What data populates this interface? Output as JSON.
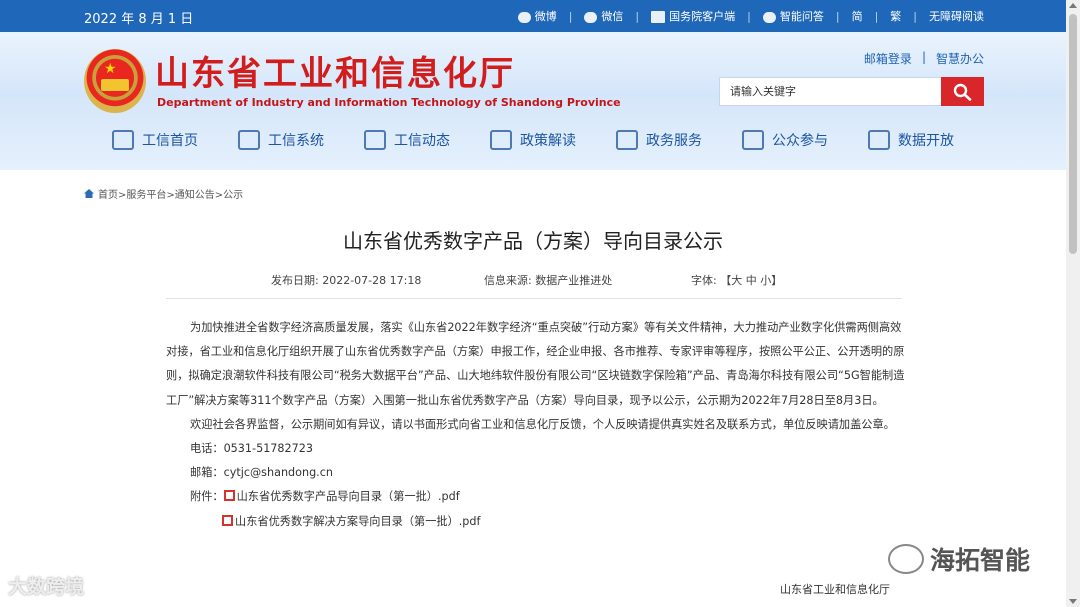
{
  "topbar": {
    "date": "2022 年 8 月 1 日",
    "links": [
      "微博",
      "微信",
      "国务院客户端",
      "智能问答",
      "简",
      "繁",
      "无障碍阅读"
    ]
  },
  "header": {
    "site_name": "山东省工业和信息化厅",
    "site_name_en": "Department of Industry and Information Technology of Shandong Province",
    "links": [
      "邮箱登录",
      "智慧办公"
    ],
    "link_sep": "|",
    "search_placeholder": "请输入关键字",
    "nav": [
      "工信首页",
      "工信系统",
      "工信动态",
      "政策解读",
      "政务服务",
      "公众参与",
      "数据开放"
    ]
  },
  "breadcrumb": "首页>服务平台>通知公告>公示",
  "article": {
    "title": "山东省优秀数字产品（方案）导向目录公示",
    "publish_date": "发布日期:  2022-07-28 17:18",
    "source": "信息来源:  数据产业推进处",
    "font_size": "字体: 【大 中 小】",
    "paragraphs": [
      "为加快推进全省数字经济高质量发展，落实《山东省2022年数字经济“重点突破”行动方案》等有关文件精神，大力推动产业数字化供需两侧高效对接，省工业和信息化厅组织开展了山东省优秀数字产品（方案）申报工作，经企业申报、各市推荐、专家评审等程序，按照公平公正、公开透明的原则，拟确定浪潮软件科技有限公司“税务大数据平台”产品、山大地纬软件股份有限公司“区块链数字保险箱”产品、青岛海尔科技有限公司“5G智能制造工厂”解决方案等311个数字产品（方案）入围第一批山东省优秀数字产品（方案）导向目录，现予以公示，公示期为2022年7月28日至8月3日。",
      "欢迎社会各界监督，公示期间如有异议，请以书面形式向省工业和信息化厅反馈，个人反映请提供真实姓名及联系方式，单位反映请加盖公章。"
    ],
    "phone": "电话：0531-51782723",
    "email": "邮箱：cytjc@shandong.cn",
    "attachment_label": "附件：",
    "attachments": [
      "山东省优秀数字产品导向目录（第一批）.pdf",
      "山东省优秀数字解决方案导向目录（第一批）.pdf"
    ],
    "signoff": "山东省工业和信息化厅"
  },
  "watermarks": [
    "海拓智能",
    "大数跨境"
  ]
}
